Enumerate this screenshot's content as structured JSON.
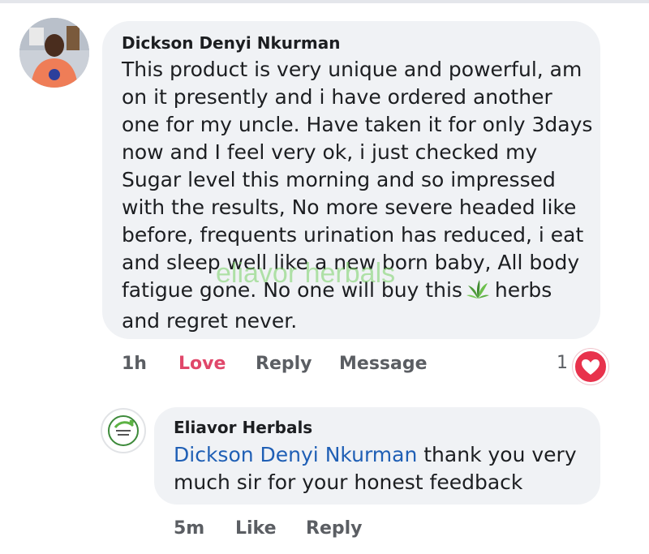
{
  "colors": {
    "bubble": "#f0f2f5",
    "love": "#e0476a",
    "mention": "#1f5fb5",
    "heart": "#e8324c",
    "watermark": "#78d264"
  },
  "comment": {
    "author": "Dickson Denyi Nkurman",
    "text_before_icon": "This product is very unique and powerful, am on it presently and i have ordered another one for my uncle. Have taken it for only 3days now and I feel very ok, i just checked my Sugar level this morning and so impressed with the results, No more severe headed like before, frequents urination has reduced, i eat and sleep well like a new born baby, All body fatigue gone. No one will buy this",
    "text_after_icon": "herbs and regret never.",
    "inline_icon": "herb-leaf-icon",
    "time": "1h",
    "actions": {
      "love": "Love",
      "reply": "Reply",
      "message": "Message"
    },
    "reaction_count": "1",
    "reaction_icon": "heart-icon"
  },
  "reply": {
    "author": "Eliavor Herbals",
    "mention": "Dickson Denyi Nkurman",
    "text": " thank you very much sir for your honest feedback",
    "time": "5m",
    "actions": {
      "like": "Like",
      "reply": "Reply"
    },
    "avatar_logo_text": "eliavor herbals"
  },
  "watermark": "eliavor herbals"
}
